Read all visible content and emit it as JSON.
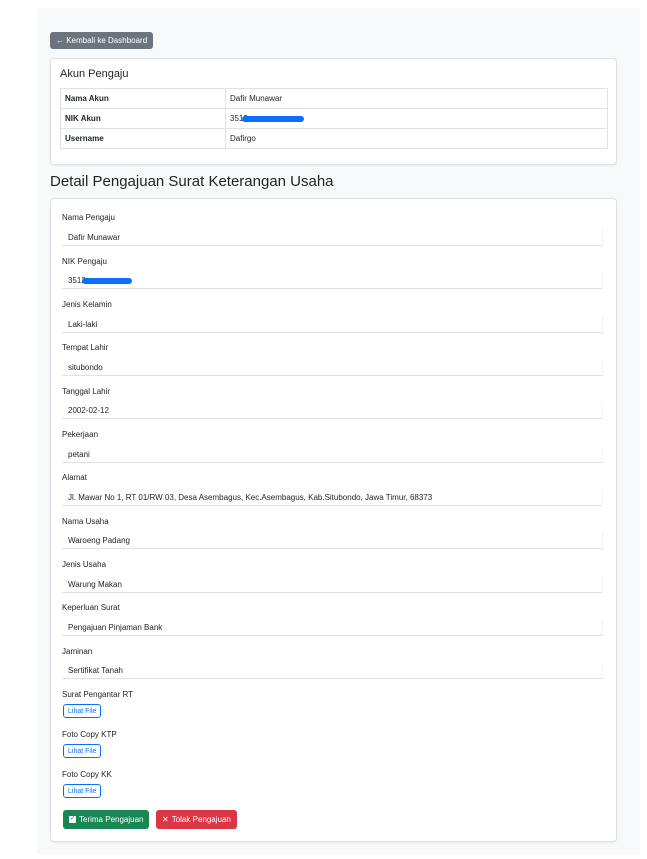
{
  "back_button": "← Kembali ke Dashboard",
  "account": {
    "title": "Akun Pengaju",
    "rows": [
      {
        "key": "Nama Akun",
        "value": "Dafir Munawar"
      },
      {
        "key": "NIK Akun",
        "value": "3512"
      },
      {
        "key": "Username",
        "value": "Dafirgo"
      }
    ]
  },
  "page_title": "Detail Pengajuan Surat Keterangan Usaha",
  "fields": {
    "nama_label": "Nama Pengaju",
    "nama_value": "Dafir Munawar",
    "nik_label": "NIK Pengaju",
    "nik_value": "3512",
    "jk_label": "Jenis Kelamin",
    "jk_value": "Laki-laki",
    "tempat_label": "Tempat Lahir",
    "tempat_value": "situbondo",
    "tanggal_label": "Tanggal Lahir",
    "tanggal_value": "2002-02-12",
    "pekerjaan_label": "Pekerjaan",
    "pekerjaan_value": "petani",
    "alamat_label": "Alamat",
    "alamat_value": "Jl. Mawar No 1, RT 01/RW 03, Desa Asembagus, Kec.Asembagus, Kab.Situbondo, Jawa Timur, 68373",
    "nama_usaha_label": "Nama Usaha",
    "nama_usaha_value": "Waroeng Padang",
    "jenis_usaha_label": "Jenis Usaha",
    "jenis_usaha_value": "Warung Makan",
    "keperluan_label": "Keperluan Surat",
    "keperluan_value": "Pengajuan Pinjaman Bank",
    "jaminan_label": "Jaminan",
    "jaminan_value": "Sertifikat Tanah"
  },
  "files": {
    "rt_label": "Surat Pengantar RT",
    "ktp_label": "Foto Copy KTP",
    "kk_label": "Foto Copy KK",
    "view_label": "Lihat File"
  },
  "actions": {
    "accept": "Terima Pengajuan",
    "reject": "Tolak Pengajuan"
  },
  "colors": {
    "accept": "#198754",
    "reject": "#dc3545",
    "secondary": "#6c757d",
    "primary": "#0d6efd"
  }
}
